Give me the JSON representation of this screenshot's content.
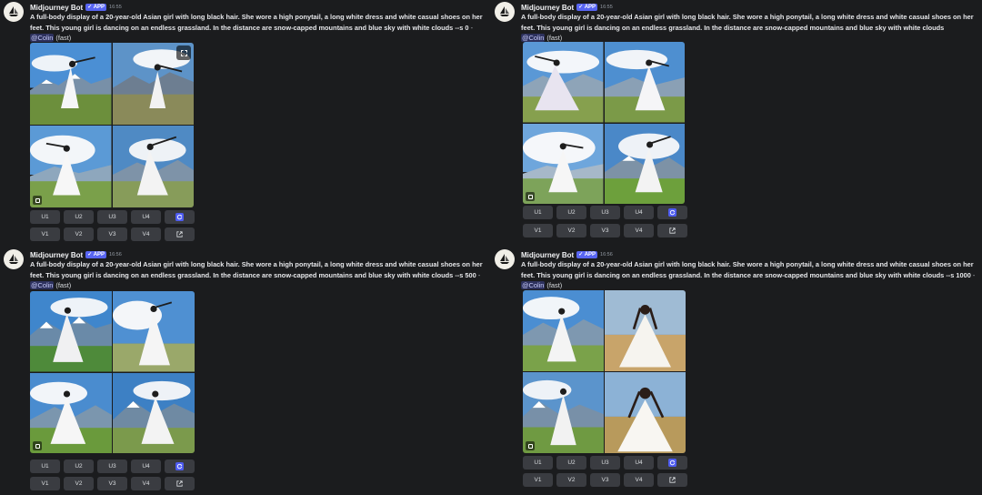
{
  "messages": [
    {
      "author": "Midjourney Bot",
      "badge": "✓ APP",
      "time": "16:55",
      "prompt": "A full-body display of a 20-year-old Asian girl with long black hair. She wore a high ponytail, a long white dress and white casual shoes on her feet. This young girl is dancing on an endless grassland. In the distance are snow-capped mountains and blue sky with white clouds --s 0",
      "separator": " - ",
      "mention": "@Colin",
      "mode": " (fast)",
      "upscale_buttons": [
        "U1",
        "U2",
        "U3",
        "U4"
      ],
      "variation_buttons": [
        "V1",
        "V2",
        "V3",
        "V4"
      ]
    },
    {
      "author": "Midjourney Bot",
      "badge": "✓ APP",
      "time": "16:55",
      "prompt": "A full-body display of a 20-year-old Asian girl with long black hair. She wore a high ponytail, a long white dress and white casual shoes on her feet. This young girl is dancing on an endless grassland. In the distance are snow-capped mountains and blue sky with white clouds",
      "separator": " - ",
      "mention": "@Colin",
      "mode": " (fast)",
      "upscale_buttons": [
        "U1",
        "U2",
        "U3",
        "U4"
      ],
      "variation_buttons": [
        "V1",
        "V2",
        "V3",
        "V4"
      ]
    },
    {
      "author": "Midjourney Bot",
      "badge": "✓ APP",
      "time": "16:56",
      "prompt": "A full-body display of a 20-year-old Asian girl with long black hair. She wore a high ponytail, a long white dress and white casual shoes on her feet. This young girl is dancing on an endless grassland. In the distance are snow-capped mountains and blue sky with white clouds --s 500",
      "separator": " - ",
      "mention": "@Colin",
      "mode": " (fast)",
      "upscale_buttons": [
        "U1",
        "U2",
        "U3",
        "U4"
      ],
      "variation_buttons": [
        "V1",
        "V2",
        "V3",
        "V4"
      ]
    },
    {
      "author": "Midjourney Bot",
      "badge": "✓ APP",
      "time": "16:56",
      "prompt": "A full-body display of a 20-year-old Asian girl with long black hair. She wore a high ponytail, a long white dress and white casual shoes on her feet. This young girl is dancing on an endless grassland. In the distance are snow-capped mountains and blue sky with white clouds --s 1000",
      "separator": " - ",
      "mention": "@Colin",
      "mode": " (fast)",
      "upscale_buttons": [
        "U1",
        "U2",
        "U3",
        "U4"
      ],
      "variation_buttons": [
        "V1",
        "V2",
        "V3",
        "V4"
      ]
    }
  ],
  "icons": {
    "avatar": "sailboat-icon",
    "reroll": "refresh-icon",
    "web": "external-link-icon",
    "expand": "expand-icon"
  },
  "colors": {
    "background": "#1b1c1e",
    "button": "#3a3c41",
    "reroll_button": "#4e5cf0",
    "badge": "#5865f2",
    "mention_text": "#c9cdfb"
  }
}
